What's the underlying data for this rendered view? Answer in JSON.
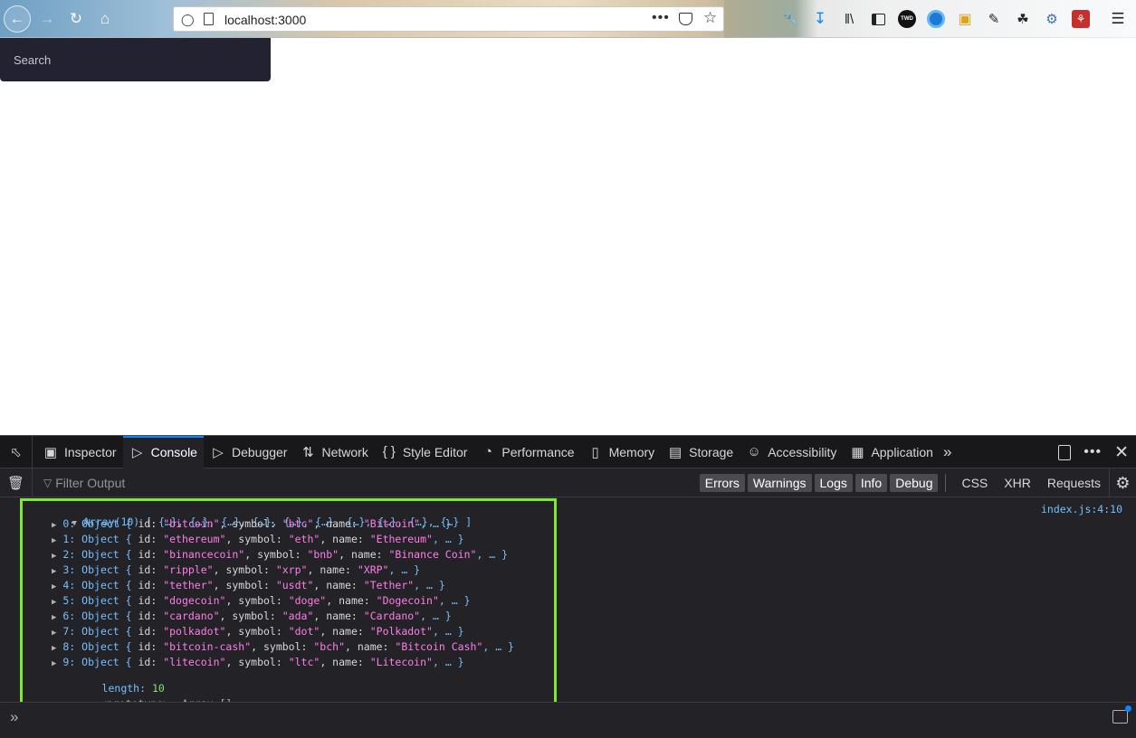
{
  "browser": {
    "url": "localhost:3000",
    "nav_icons": [
      "back-icon",
      "forward-icon",
      "reload-icon",
      "home-icon"
    ],
    "toolbar_icons": [
      "wrench-icon",
      "download-icon",
      "library-icon",
      "sidebar-icon",
      "twd-extension-icon",
      "blue-extension-icon",
      "monitor-extension-icon",
      "notes-icon",
      "ghost-extension-icon",
      "puzzle-extension-icon",
      "red-extension-icon",
      "menu-icon"
    ],
    "twd_label": "TWD"
  },
  "page": {
    "search_placeholder": "Search"
  },
  "devtools": {
    "tabs": [
      {
        "label": "Inspector",
        "icon": "inspector-icon"
      },
      {
        "label": "Console",
        "icon": "console-icon",
        "active": true
      },
      {
        "label": "Debugger",
        "icon": "debugger-icon"
      },
      {
        "label": "Network",
        "icon": "network-icon"
      },
      {
        "label": "Style Editor",
        "icon": "style-editor-icon"
      },
      {
        "label": "Performance",
        "icon": "performance-icon"
      },
      {
        "label": "Memory",
        "icon": "memory-icon"
      },
      {
        "label": "Storage",
        "icon": "storage-icon"
      },
      {
        "label": "Accessibility",
        "icon": "accessibility-icon"
      },
      {
        "label": "Application",
        "icon": "application-icon"
      }
    ],
    "filter_placeholder": "Filter Output",
    "filter_buttons": [
      "Errors",
      "Warnings",
      "Logs",
      "Info",
      "Debug"
    ],
    "filter_plain": [
      "CSS",
      "XHR",
      "Requests"
    ],
    "source_link": "index.js:4:10",
    "array_header": "Array(10) [ {…}, {…}, {…}, {…}, {…}, {…}, {…}, {…}, {…}, {…} ]",
    "items": [
      {
        "index": "0",
        "id": "\"bitcoin\"",
        "symbol": "\"btc\"",
        "name": "\"Bitcoin\""
      },
      {
        "index": "1",
        "id": "\"ethereum\"",
        "symbol": "\"eth\"",
        "name": "\"Ethereum\""
      },
      {
        "index": "2",
        "id": "\"binancecoin\"",
        "symbol": "\"bnb\"",
        "name": "\"Binance Coin\""
      },
      {
        "index": "3",
        "id": "\"ripple\"",
        "symbol": "\"xrp\"",
        "name": "\"XRP\""
      },
      {
        "index": "4",
        "id": "\"tether\"",
        "symbol": "\"usdt\"",
        "name": "\"Tether\""
      },
      {
        "index": "5",
        "id": "\"dogecoin\"",
        "symbol": "\"doge\"",
        "name": "\"Dogecoin\""
      },
      {
        "index": "6",
        "id": "\"cardano\"",
        "symbol": "\"ada\"",
        "name": "\"Cardano\""
      },
      {
        "index": "7",
        "id": "\"polkadot\"",
        "symbol": "\"dot\"",
        "name": "\"Polkadot\""
      },
      {
        "index": "8",
        "id": "\"bitcoin-cash\"",
        "symbol": "\"bch\"",
        "name": "\"Bitcoin Cash\""
      },
      {
        "index": "9",
        "id": "\"litecoin\"",
        "symbol": "\"ltc\"",
        "name": "\"Litecoin\""
      }
    ],
    "length_label": "length:",
    "length_value": "10",
    "prototype_label": "<prototype>:",
    "prototype_value": "Array []",
    "highlight_color": "#7fe92f"
  }
}
